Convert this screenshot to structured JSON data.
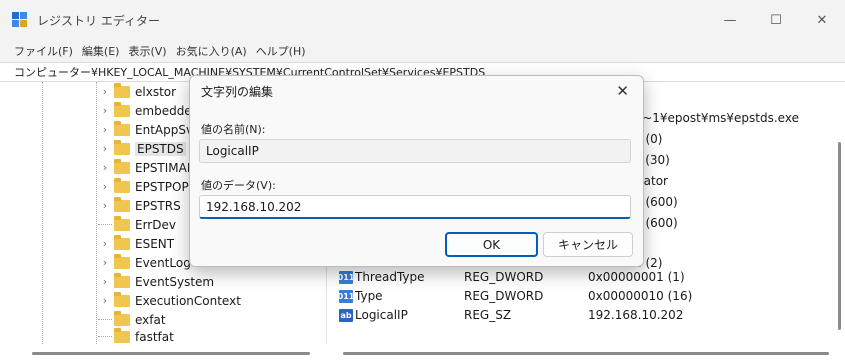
{
  "window": {
    "title": "レジストリ エディター",
    "controls": {
      "minimize": "—",
      "maximize": "☐",
      "close": "✕"
    }
  },
  "menu": [
    "ファイル(F)",
    "編集(E)",
    "表示(V)",
    "お気に入り(A)",
    "ヘルプ(H)"
  ],
  "address": "コンピューター¥HKEY_LOCAL_MACHINE¥SYSTEM¥CurrentControlSet¥Services¥EPSTDS",
  "tree": {
    "items": [
      {
        "label": "elxstor",
        "expandable": true,
        "selected": false
      },
      {
        "label": "embeddec",
        "expandable": true,
        "selected": false
      },
      {
        "label": "EntAppSv",
        "expandable": true,
        "selected": false
      },
      {
        "label": "EPSTDS",
        "expandable": true,
        "selected": true
      },
      {
        "label": "EPSTIMAP",
        "expandable": true,
        "selected": false
      },
      {
        "label": "EPSTPOP3",
        "expandable": true,
        "selected": false
      },
      {
        "label": "EPSTRS",
        "expandable": true,
        "selected": false
      },
      {
        "label": "ErrDev",
        "expandable": false,
        "selected": false
      },
      {
        "label": "ESENT",
        "expandable": true,
        "selected": false
      },
      {
        "label": "EventLog",
        "expandable": true,
        "selected": false
      },
      {
        "label": "EventSystem",
        "expandable": true,
        "selected": false
      },
      {
        "label": "ExecutionContext",
        "expandable": true,
        "selected": false
      },
      {
        "label": "exfat",
        "expandable": false,
        "selected": false
      },
      {
        "label": "fastfat",
        "expandable": false,
        "selected": false
      }
    ]
  },
  "values_partial": [
    "A~1¥epost¥ms¥epstds.exe",
    "0 (0)",
    "e (30)",
    "trator",
    "8 (600)",
    "8 (600)",
    "2 (2)"
  ],
  "values": [
    {
      "name": "ThreadType",
      "type": "REG_DWORD",
      "data": "0x00000001 (1)",
      "icon": "binary-value-icon",
      "glyph": "011"
    },
    {
      "name": "Type",
      "type": "REG_DWORD",
      "data": "0x00000010 (16)",
      "icon": "binary-value-icon",
      "glyph": "011"
    },
    {
      "name": "LogicalIP",
      "type": "REG_SZ",
      "data": "192.168.10.202",
      "icon": "string-value-icon",
      "glyph": "ab"
    }
  ],
  "dialog": {
    "title": "文字列の編集",
    "close": "✕",
    "name_label": "値の名前(N):",
    "name_value": "LogicalIP",
    "data_label": "値のデータ(V):",
    "data_value": "192.168.10.202",
    "ok": "OK",
    "cancel": "キャンセル"
  }
}
